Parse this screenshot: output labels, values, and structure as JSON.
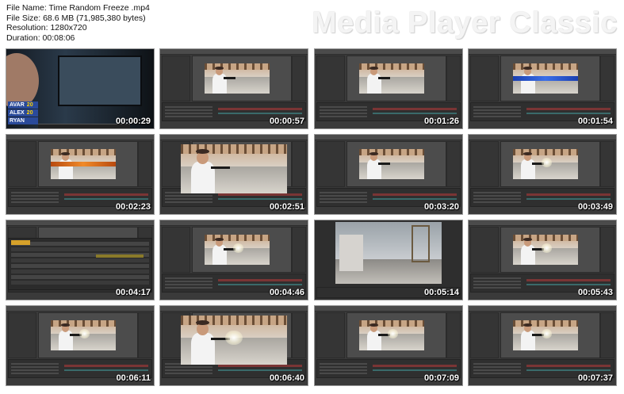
{
  "file_info": {
    "file_name": "File Name: Time Random Freeze .mp4",
    "file_size": "File Size: 68.6 MB (71,985,380 bytes)",
    "resolution": "Resolution: 1280x720",
    "duration": "Duration: 00:08:06"
  },
  "brand": "Media Player Classic",
  "thumbnails": [
    {
      "time": "00:00:29",
      "kind": "camera"
    },
    {
      "time": "00:00:57",
      "kind": "ae-video"
    },
    {
      "time": "00:01:26",
      "kind": "ae-video"
    },
    {
      "time": "00:01:54",
      "kind": "ae-blue"
    },
    {
      "time": "00:02:23",
      "kind": "ae-orange"
    },
    {
      "time": "00:02:51",
      "kind": "full-video"
    },
    {
      "time": "00:03:20",
      "kind": "ae-video"
    },
    {
      "time": "00:03:49",
      "kind": "ae-flash"
    },
    {
      "time": "00:04:17",
      "kind": "ae-timeline"
    },
    {
      "time": "00:04:46",
      "kind": "ae-flash"
    },
    {
      "time": "00:05:14",
      "kind": "full-empty"
    },
    {
      "time": "00:05:43",
      "kind": "ae-flash"
    },
    {
      "time": "00:06:11",
      "kind": "ae-flash"
    },
    {
      "time": "00:06:40",
      "kind": "full-video"
    },
    {
      "time": "00:07:09",
      "kind": "ae-flash"
    },
    {
      "time": "00:07:37",
      "kind": "ae-flash"
    }
  ],
  "camera_labels": [
    "AVAR",
    "20",
    "ALEX",
    "20",
    "RYAN"
  ]
}
